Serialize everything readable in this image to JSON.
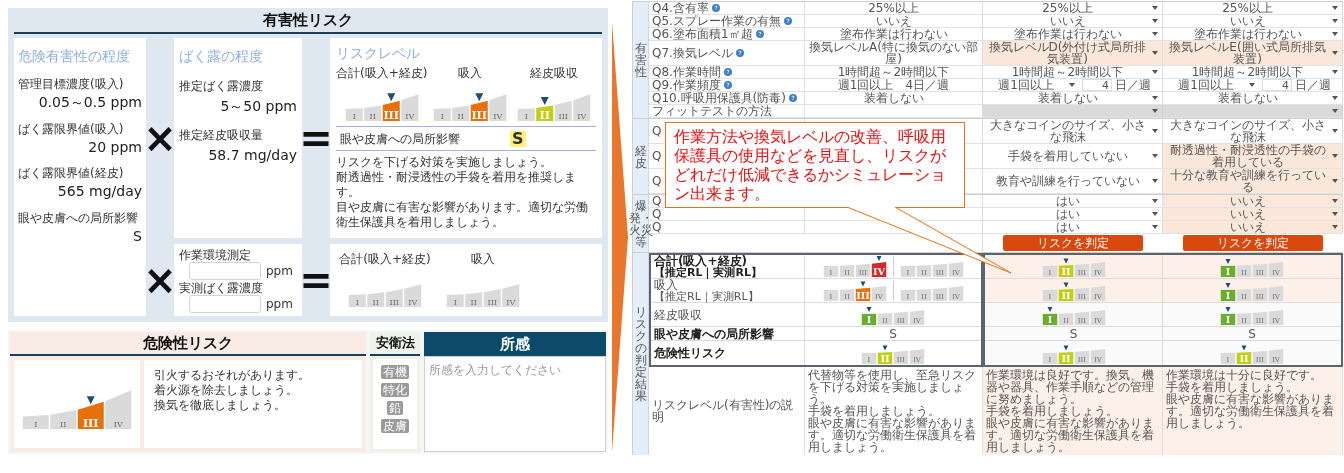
{
  "harmful_risk": {
    "title": "有害性リスク",
    "hazard_degree": {
      "title": "危険有害性の程度",
      "items": [
        {
          "label": "管理目標濃度(吸入)",
          "value": "0.05～0.5 ppm"
        },
        {
          "label": "ばく露限界値(吸入)",
          "value": "20 ppm"
        },
        {
          "label": "ばく露限界値(経皮)",
          "value": "565 mg/day"
        },
        {
          "label": "眼や皮膚への局所影響",
          "value": "S"
        }
      ]
    },
    "operators": [
      "×",
      "=",
      "×",
      "="
    ],
    "exposure": {
      "title": "ばく露の程度",
      "items": [
        {
          "label": "推定ばく露濃度",
          "value": "5～50 ppm"
        },
        {
          "label": "推定経皮吸収量",
          "value": "58.7 mg/day"
        }
      ]
    },
    "risk_level": {
      "title": "リスクレベル",
      "gauges": [
        {
          "label": "合計(吸入+経皮)",
          "color": "#e8700a",
          "segments": [
            {
              "label": "I",
              "selected": false
            },
            {
              "label": "II",
              "selected": false
            },
            {
              "label": "III",
              "selected": true
            },
            {
              "label": "IV",
              "selected": false
            }
          ]
        },
        {
          "label": "吸入",
          "color": "#e8700a",
          "segments": [
            {
              "label": "I",
              "selected": false
            },
            {
              "label": "II",
              "selected": false
            },
            {
              "label": "III",
              "selected": true
            },
            {
              "label": "IV",
              "selected": false
            }
          ]
        },
        {
          "label": "経皮吸収",
          "color": "#c1cf13",
          "segments": [
            {
              "label": "I",
              "selected": false
            },
            {
              "label": "II",
              "selected": true
            },
            {
              "label": "III",
              "selected": false
            },
            {
              "label": "IV",
              "selected": false
            }
          ]
        }
      ],
      "local_effect": {
        "label": "眼や皮膚への局所影響",
        "value": "S"
      },
      "advice": [
        "リスクを下げる対策を実施しましょう。",
        "耐透過性・耐浸透性の手袋を着用を推奨します。",
        "目や皮膚に有害な影響があります。適切な労働衛生保護具を着用しましょう。"
      ]
    },
    "measurement": {
      "fields": [
        {
          "label": "作業環境測定",
          "unit": "ppm"
        },
        {
          "label": "実測ばく露濃度",
          "unit": "ppm"
        }
      ]
    },
    "measured_risk": {
      "gauges": [
        {
          "label": "合計(吸入+経皮)",
          "segments": [
            {
              "label": "I",
              "selected": false
            },
            {
              "label": "II",
              "selected": false
            },
            {
              "label": "III",
              "selected": false
            },
            {
              "label": "IV",
              "selected": false
            }
          ]
        },
        {
          "label": "吸入",
          "segments": [
            {
              "label": "I",
              "selected": false
            },
            {
              "label": "II",
              "selected": false
            },
            {
              "label": "III",
              "selected": false
            },
            {
              "label": "IV",
              "selected": false
            }
          ]
        }
      ]
    }
  },
  "danger_risk": {
    "title": "危険性リスク",
    "gauge": {
      "color": "#e8700a",
      "segments": [
        {
          "label": "I",
          "selected": false
        },
        {
          "label": "II",
          "selected": false
        },
        {
          "label": "III",
          "selected": true
        },
        {
          "label": "IV",
          "selected": false
        }
      ]
    },
    "advice": [
      "引火するおそれがあります。",
      "着火源を除去しましょう。",
      "換気を徹底しましょう。"
    ]
  },
  "safety_law": {
    "title": "安衛法",
    "tags": [
      "有機",
      "特化",
      "鉛",
      "皮膚"
    ]
  },
  "remarks": {
    "title": "所感",
    "placeholder": "所感を入力してください"
  },
  "callout": "作業方法や換気レベルの改善、呼吸用保護具の使用などを見直し、リスクがどれだけ低減できるかシミュレーション出来ます。",
  "simulation": {
    "groups": [
      {
        "label": "有害性",
        "rows": [
          {
            "label": "Q4.含有率",
            "help": true,
            "kind": "select",
            "current": "25%以上",
            "sims": [
              {
                "value": "25%以上",
                "changed": false
              },
              {
                "value": "25%以上",
                "changed": false
              }
            ]
          },
          {
            "label": "Q5.スプレー作業の有無",
            "help": true,
            "kind": "select",
            "current": "いいえ",
            "sims": [
              {
                "value": "いいえ",
                "changed": false
              },
              {
                "value": "いいえ",
                "changed": false
              }
            ]
          },
          {
            "label": "Q6.塗布面積1㎡超",
            "help": true,
            "kind": "select",
            "current": "塗布作業は行わない",
            "sims": [
              {
                "value": "塗布作業は行わない",
                "changed": false
              },
              {
                "value": "塗布作業は行わない",
                "changed": false
              }
            ]
          },
          {
            "label": "Q7.換気レベル",
            "help": true,
            "kind": "select",
            "current": "換気レベルA(特に換気のない部屋)",
            "sims": [
              {
                "value": "換気レベルD(外付け式局所排気装置)",
                "changed": true
              },
              {
                "value": "換気レベルE(囲い式局所排気装置)",
                "changed": true
              }
            ]
          },
          {
            "label": "Q8.作業時間",
            "help": true,
            "kind": "select",
            "current": "1時間超～2時間以下",
            "sims": [
              {
                "value": "1時間超～2時間以下",
                "changed": false
              },
              {
                "value": "1時間超～2時間以下",
                "changed": false
              }
            ]
          },
          {
            "label": "Q9.作業頻度",
            "help": true,
            "kind": "frequency",
            "current": "週1回以上　4日／週",
            "sims": [
              {
                "value": "週1回以上",
                "days": "4",
                "unit": "日／週",
                "changed": false
              },
              {
                "value": "週1回以上",
                "days": "4",
                "unit": "日／週",
                "changed": false
              }
            ]
          },
          {
            "label": "Q10.呼吸用保護具(防毒)",
            "help": true,
            "kind": "select",
            "current": "装着しない",
            "sims": [
              {
                "value": "装着しない",
                "changed": false
              },
              {
                "value": "装着しない",
                "changed": false
              }
            ]
          },
          {
            "label": "フィットテストの方法",
            "help": false,
            "kind": "disabled"
          }
        ]
      },
      {
        "label": "経皮",
        "rows": [
          {
            "label": "Q",
            "kind": "select",
            "sims": [
              {
                "value": "大きなコインのサイズ、小さな飛沫",
                "changed": false
              },
              {
                "value": "大きなコインのサイズ、小さな飛沫",
                "changed": false
              }
            ]
          },
          {
            "label": "Q",
            "kind": "select",
            "sims": [
              {
                "value": "手袋を着用していない",
                "changed": false
              },
              {
                "value": "耐透過性・耐浸透性の手袋の着用している",
                "changed": true
              }
            ]
          },
          {
            "label": "Q",
            "kind": "select",
            "sims": [
              {
                "value": "教育や訓練を行っていない",
                "changed": false
              },
              {
                "value": "十分な教育や訓練を行っている",
                "changed": true
              }
            ]
          }
        ]
      },
      {
        "label": "爆発・火災等",
        "rows": [
          {
            "label": "Q",
            "kind": "select",
            "sims": [
              {
                "value": "はい",
                "changed": false
              },
              {
                "value": "いいえ",
                "changed": true
              }
            ]
          },
          {
            "label": "Q",
            "kind": "select",
            "sims": [
              {
                "value": "はい",
                "changed": false
              },
              {
                "value": "いいえ",
                "changed": true
              }
            ]
          },
          {
            "label": "Q",
            "kind": "select",
            "sims": [
              {
                "value": "はい",
                "changed": false
              },
              {
                "value": "いいえ",
                "changed": true
              }
            ]
          }
        ],
        "buttons": [
          "リスクを判定",
          "リスクを判定"
        ]
      }
    ],
    "results": {
      "label": "リスクの判定結果",
      "rows": [
        {
          "kind": "gauges",
          "label": "合計(吸入+経皮)",
          "sublabel": "【推定RL｜実測RL】",
          "bold": true,
          "current": [
            {
              "color": "#d7262b",
              "segments": [
                {
                  "label": "I",
                  "selected": false
                },
                {
                  "label": "II",
                  "selected": false
                },
                {
                  "label": "III",
                  "selected": false
                },
                {
                  "label": "IV",
                  "selected": true
                }
              ]
            },
            {
              "segments": [
                {
                  "label": "I",
                  "selected": false
                },
                {
                  "label": "II",
                  "selected": false
                },
                {
                  "label": "III",
                  "selected": false
                },
                {
                  "label": "IV",
                  "selected": false
                }
              ]
            }
          ],
          "sims": [
            {
              "changed": true,
              "gauge": {
                "color": "#c1cf13",
                "segments": [
                  {
                    "label": "I",
                    "selected": false
                  },
                  {
                    "label": "II",
                    "selected": true
                  },
                  {
                    "label": "III",
                    "selected": false
                  },
                  {
                    "label": "IV",
                    "selected": false
                  }
                ]
              }
            },
            {
              "changed": true,
              "gauge": {
                "color": "#6aae2f",
                "segments": [
                  {
                    "label": "I",
                    "selected": true
                  },
                  {
                    "label": "II",
                    "selected": false
                  },
                  {
                    "label": "III",
                    "selected": false
                  },
                  {
                    "label": "IV",
                    "selected": false
                  }
                ]
              }
            }
          ]
        },
        {
          "kind": "gauges",
          "label": "吸入",
          "sublabel": "【推定RL｜実測RL】",
          "bold": false,
          "current": [
            {
              "color": "#e8700a",
              "segments": [
                {
                  "label": "I",
                  "selected": false
                },
                {
                  "label": "II",
                  "selected": false
                },
                {
                  "label": "III",
                  "selected": true
                },
                {
                  "label": "IV",
                  "selected": false
                }
              ]
            },
            {
              "segments": [
                {
                  "label": "I",
                  "selected": false
                },
                {
                  "label": "II",
                  "selected": false
                },
                {
                  "label": "III",
                  "selected": false
                },
                {
                  "label": "IV",
                  "selected": false
                }
              ]
            }
          ],
          "sims": [
            {
              "changed": true,
              "gauge": {
                "color": "#c1cf13",
                "segments": [
                  {
                    "label": "I",
                    "selected": false
                  },
                  {
                    "label": "II",
                    "selected": true
                  },
                  {
                    "label": "III",
                    "selected": false
                  },
                  {
                    "label": "IV",
                    "selected": false
                  }
                ]
              }
            },
            {
              "changed": true,
              "gauge": {
                "color": "#6aae2f",
                "segments": [
                  {
                    "label": "I",
                    "selected": true
                  },
                  {
                    "label": "II",
                    "selected": false
                  },
                  {
                    "label": "III",
                    "selected": false
                  },
                  {
                    "label": "IV",
                    "selected": false
                  }
                ]
              }
            }
          ]
        },
        {
          "kind": "gauges",
          "label": "経皮吸収",
          "bold": false,
          "current": [
            {
              "color": "#6aae2f",
              "segments": [
                {
                  "label": "I",
                  "selected": true
                },
                {
                  "label": "II",
                  "selected": false
                },
                {
                  "label": "III",
                  "selected": false
                },
                {
                  "label": "IV",
                  "selected": false
                }
              ]
            }
          ],
          "sims": [
            {
              "changed": false,
              "gauge": {
                "color": "#6aae2f",
                "segments": [
                  {
                    "label": "I",
                    "selected": true
                  },
                  {
                    "label": "II",
                    "selected": false
                  },
                  {
                    "label": "III",
                    "selected": false
                  },
                  {
                    "label": "IV",
                    "selected": false
                  }
                ]
              }
            },
            {
              "changed": false,
              "gauge": {
                "color": "#6aae2f",
                "segments": [
                  {
                    "label": "I",
                    "selected": true
                  },
                  {
                    "label": "II",
                    "selected": false
                  },
                  {
                    "label": "III",
                    "selected": false
                  },
                  {
                    "label": "IV",
                    "selected": false
                  }
                ]
              }
            }
          ]
        },
        {
          "kind": "text",
          "label": "眼や皮膚への局所影響",
          "bold": true,
          "current": "S",
          "sims": [
            {
              "changed": false,
              "value": "S"
            },
            {
              "changed": false,
              "value": "S"
            }
          ]
        },
        {
          "kind": "gauges",
          "label": "危険性リスク",
          "bold": true,
          "current": [
            {
              "color": "#c1cf13",
              "segments": [
                {
                  "label": "I",
                  "selected": false
                },
                {
                  "label": "II",
                  "selected": true
                },
                {
                  "label": "III",
                  "selected": false
                },
                {
                  "label": "IV",
                  "selected": false
                }
              ]
            }
          ],
          "sims": [
            {
              "changed": false,
              "gauge": {
                "color": "#c1cf13",
                "segments": [
                  {
                    "label": "I",
                    "selected": false
                  },
                  {
                    "label": "II",
                    "selected": true
                  },
                  {
                    "label": "III",
                    "selected": false
                  },
                  {
                    "label": "IV",
                    "selected": false
                  }
                ]
              }
            },
            {
              "changed": false,
              "gauge": {
                "color": "#c1cf13",
                "segments": [
                  {
                    "label": "I",
                    "selected": false
                  },
                  {
                    "label": "II",
                    "selected": true
                  },
                  {
                    "label": "III",
                    "selected": false
                  },
                  {
                    "label": "IV",
                    "selected": false
                  }
                ]
              }
            }
          ]
        }
      ],
      "description": {
        "label": "リスクレベル(有害性)の説明",
        "current": [
          "代替物等を使用し、至急リスクを下げる対策を実施しましょう。",
          "手袋を着用しましょう。",
          "眼や皮膚に有害な影響があります。適切な労働衛生保護具を着用しましょう。"
        ],
        "sims": [
          {
            "changed": true,
            "lines": [
              "作業環境は良好です。換気、機器や器具、作業手順などの管理に努めましょう。",
              "手袋を着用しましょう。",
              "眼や皮膚に有害な影響があります。適切な労働衛生保護具を着用しましょう。"
            ]
          },
          {
            "changed": true,
            "lines": [
              "作業環境は十分に良好です。",
              "手袋を着用しましょう。",
              "眼や皮膚に有害な影響があります。適切な労働衛生保護具を着用しましょう。"
            ]
          }
        ]
      }
    }
  }
}
